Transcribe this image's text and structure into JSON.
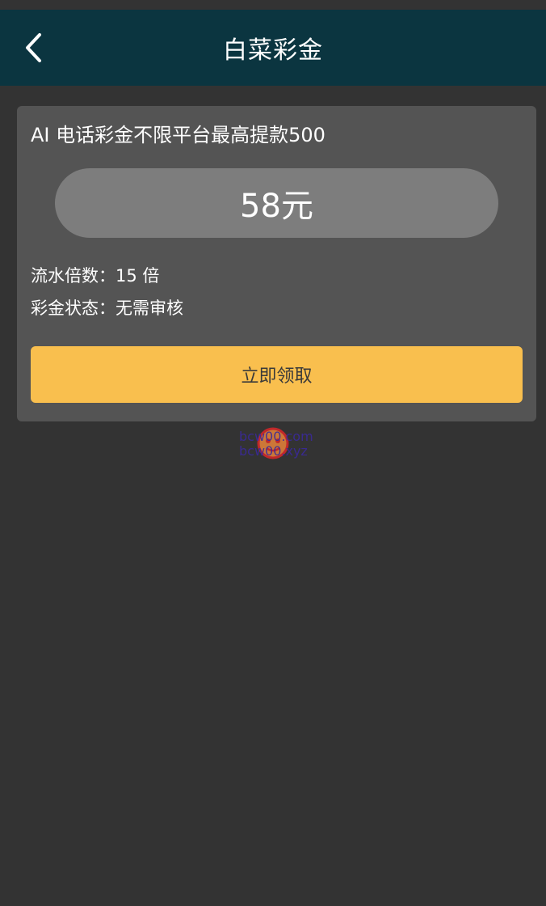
{
  "nav": {
    "title": "白菜彩金",
    "back_icon": "chevron-left-icon"
  },
  "card": {
    "title": "AI 电话彩金不限平台最高提款500",
    "amount": "58元",
    "turnover_label": "流水倍数：",
    "turnover_value": "15 倍",
    "status_label": "彩金状态：",
    "status_value": "无需审核",
    "claim_button": "立即领取"
  },
  "watermark": {
    "line1": "bcw00.com",
    "line2": "bcw00.xyz"
  },
  "colors": {
    "background": "#333333",
    "nav_bar": "#0b3540",
    "card": "#545454",
    "amount_pill": "#7d7d7d",
    "claim_button": "#f9bf4e"
  }
}
